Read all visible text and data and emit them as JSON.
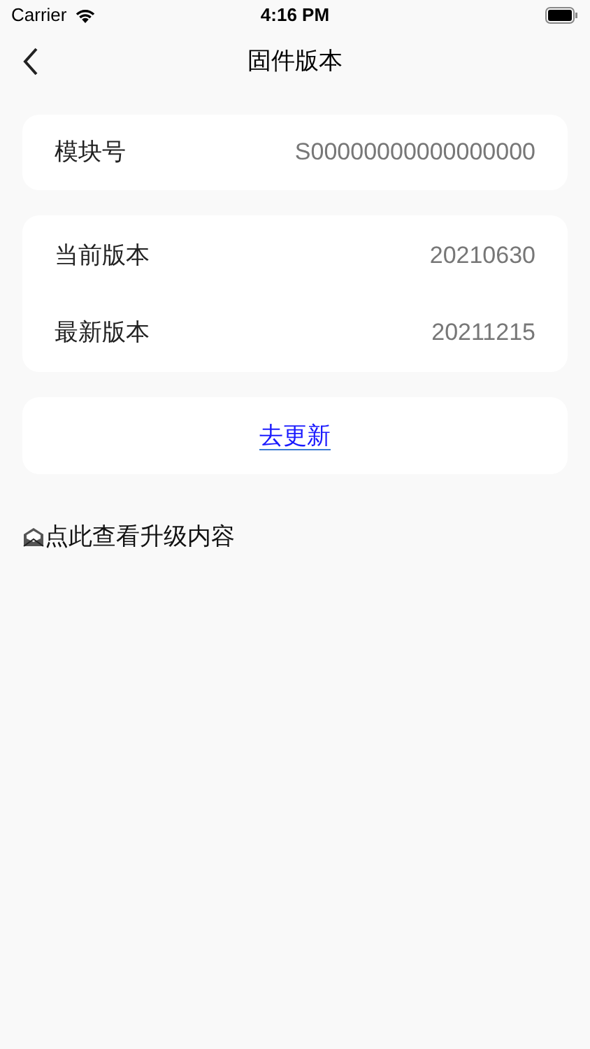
{
  "status_bar": {
    "carrier": "Carrier",
    "time": "4:16 PM"
  },
  "nav": {
    "title": "固件版本"
  },
  "module": {
    "label": "模块号",
    "value": "S00000000000000000"
  },
  "versions": [
    {
      "label": "当前版本",
      "value": "20210630"
    },
    {
      "label": "最新版本",
      "value": "20211215"
    }
  ],
  "update_link": "去更新",
  "notes_link": "点此查看升级内容"
}
